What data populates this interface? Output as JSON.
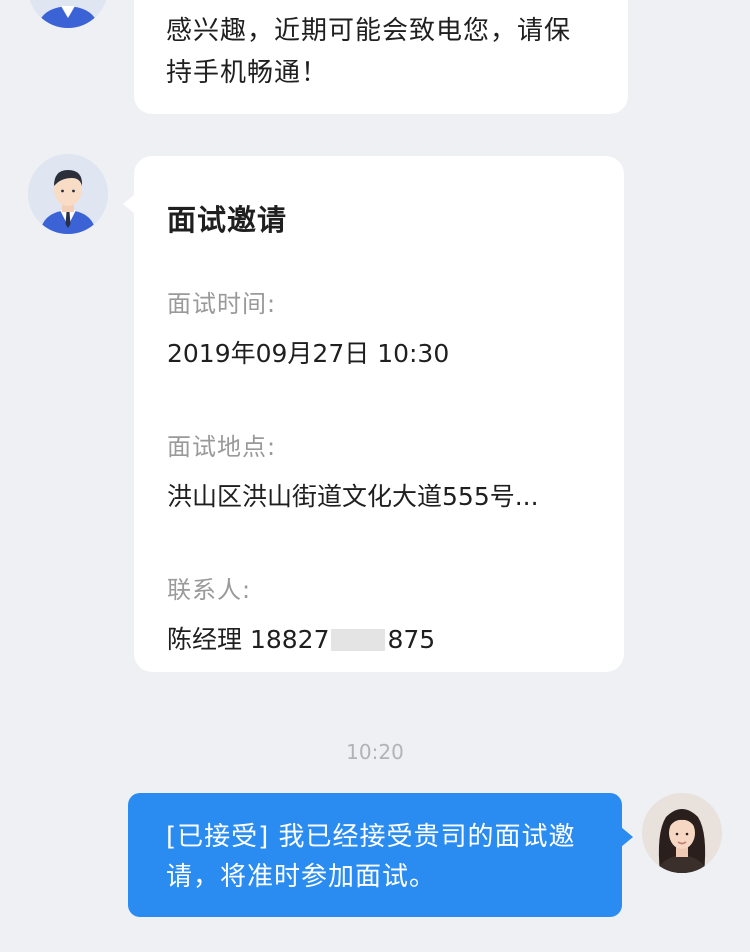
{
  "messages": {
    "top_partial": {
      "text": "感兴趣，近期可能会致电您，请保持手机畅通！"
    },
    "interview_card": {
      "title": "面试邀请",
      "time_label": "面试时间:",
      "time_value": "2019年09月27日 10:30",
      "location_label": "面试地点:",
      "location_value": "洪山区洪山街道文化大道555号...",
      "contact_label": "联系人:",
      "contact_name_prefix": "陈经理 18827",
      "contact_phone_suffix": "875"
    },
    "timestamp": "10:20",
    "my_reply": {
      "text": "[已接受] 我已经接受贵司的面试邀请，将准时参加面试。"
    }
  },
  "colors": {
    "background": "#eef0f4",
    "bubble_white": "#ffffff",
    "bubble_blue": "#2a8cf0",
    "label_gray": "#9a9a9a",
    "text_dark": "#1f1f1f"
  },
  "icons": {
    "recruiter_avatar": "recruiter-avatar-icon",
    "user_avatar": "user-avatar-photo"
  }
}
